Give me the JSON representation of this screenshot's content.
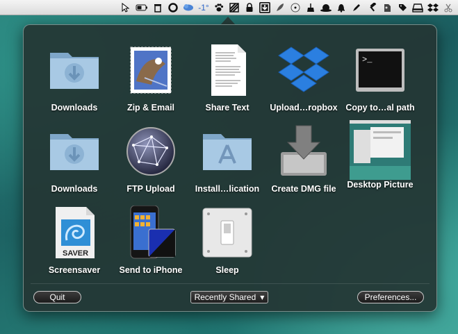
{
  "menubar": {
    "temperature": "-1°",
    "icons": [
      "pointer-icon",
      "battery-icon",
      "trash-icon",
      "circle-icon",
      "weather-icon",
      "paw-icon",
      "hatched-square-icon",
      "lock-icon",
      "download-tray-icon",
      "feather-icon",
      "compass-icon",
      "broom-icon",
      "bowler-hat-icon",
      "bell-icon",
      "pen-icon",
      "hammer-icon",
      "evernote-icon",
      "tag-icon",
      "drive-icon",
      "dropbox-icon",
      "scissors-icon"
    ]
  },
  "items": [
    {
      "label": "Downloads",
      "icon": "downloads-folder-icon"
    },
    {
      "label": "Zip & Email",
      "icon": "mail-stamp-icon"
    },
    {
      "label": "Share Text",
      "icon": "text-document-icon"
    },
    {
      "label": "Upload…ropbox",
      "icon": "dropbox-icon"
    },
    {
      "label": "Copy to…al path",
      "icon": "terminal-icon"
    },
    {
      "label": "Downloads",
      "icon": "downloads-folder-icon"
    },
    {
      "label": "FTP Upload",
      "icon": "network-globe-icon"
    },
    {
      "label": "Install…lication",
      "icon": "applications-folder-icon"
    },
    {
      "label": "Create DMG file",
      "icon": "disk-image-icon"
    },
    {
      "label": "Desktop Picture",
      "icon": "desktop-picture-icon"
    },
    {
      "label": "Screensaver",
      "icon": "screensaver-icon"
    },
    {
      "label": "Send to iPhone",
      "icon": "iphone-icon"
    },
    {
      "label": "Sleep",
      "icon": "switch-icon"
    }
  ],
  "footer": {
    "quit_label": "Quit",
    "recently_shared_label": "Recently Shared",
    "preferences_label": "Preferences..."
  },
  "colors": {
    "panel_bg": "#243634",
    "folder_blue": "#8fb6d6",
    "dropbox_blue": "#2b7fe0"
  }
}
